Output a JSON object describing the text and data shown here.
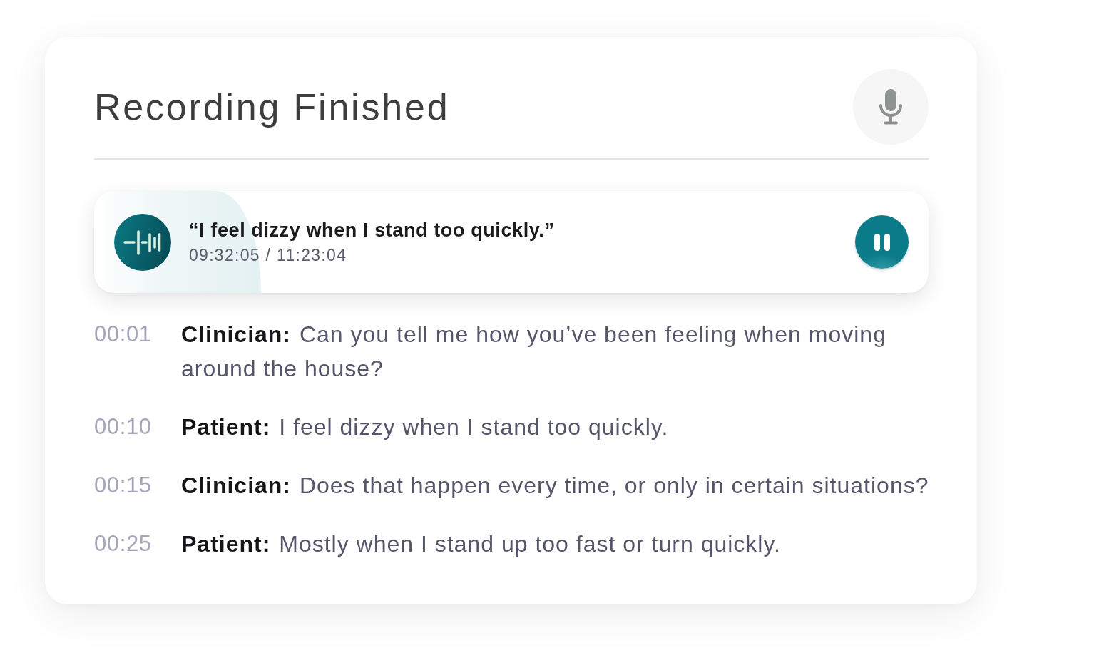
{
  "title": "Recording Finished",
  "player": {
    "quote": "“I feel dizzy when I stand too quickly.”",
    "time": "09:32:05 / 11:23:04",
    "level": 0.2,
    "playing": true
  },
  "transcript": [
    {
      "time": "00:01",
      "speaker": "Clinician:",
      "text": "Can you tell me how you’ve been feeling when moving around the house?"
    },
    {
      "time": "00:10",
      "speaker": "Patient:",
      "text": "I feel dizzy when I stand too quickly."
    },
    {
      "time": "00:15",
      "speaker": "Clinician:",
      "text": "Does that happen every time, or only in certain situations?"
    },
    {
      "time": "00:25",
      "speaker": "Patient:",
      "text": "Mostly when I stand up too fast or turn quickly."
    }
  ]
}
